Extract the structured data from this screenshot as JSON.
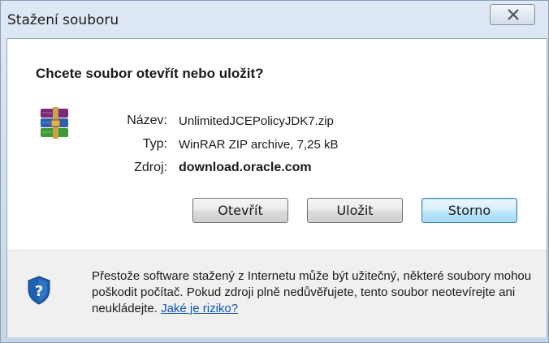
{
  "window": {
    "title": "Stažení souboru",
    "close_icon": "close-icon"
  },
  "dialog": {
    "question": "Chcete soubor otevřít nebo uložit?",
    "file_icon": "winrar-archive-icon",
    "fields": {
      "name_label": "Název:",
      "name_value": "UnlimitedJCEPolicyJDK7.zip",
      "type_label": "Typ:",
      "type_value": "WinRAR ZIP archive, 7,25 kB",
      "source_label": "Zdroj:",
      "source_value": "download.oracle.com"
    },
    "buttons": {
      "open": "Otevřít",
      "save": "Uložit",
      "cancel": "Storno"
    }
  },
  "footer": {
    "icon": "security-shield-icon",
    "warning_text": "Přestože software stažený z Internetu může být užitečný, některé soubory mohou poškodit počítač. Pokud zdroji plně nedůvěřujete, tento soubor neotevírejte ani neukládejte. ",
    "risk_link": "Jaké je riziko?"
  },
  "colors": {
    "link": "#0a55b8",
    "default_button_border": "#3c7fb1",
    "shield_blue": "#1f5fb0"
  }
}
